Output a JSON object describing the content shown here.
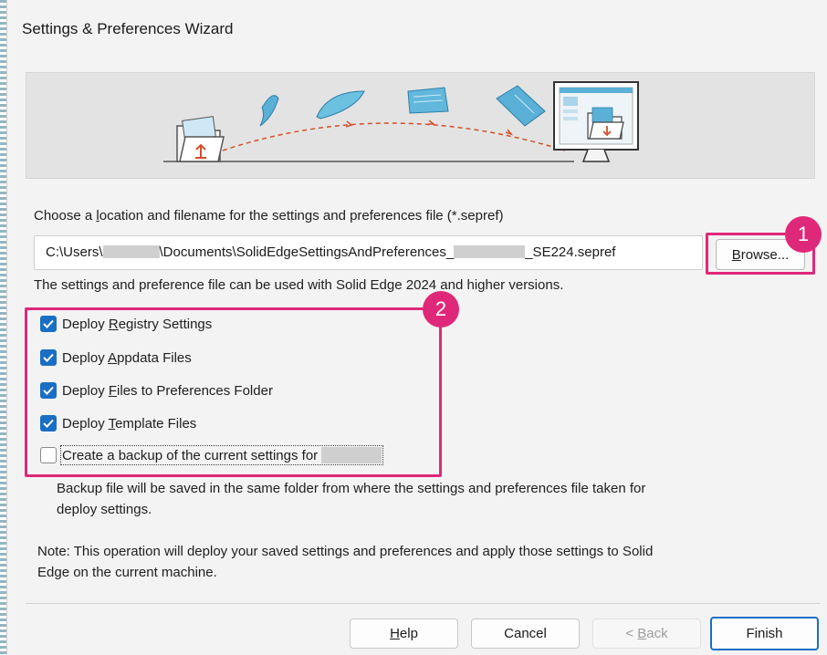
{
  "window": {
    "title": "Settings & Preferences Wizard"
  },
  "file_section": {
    "prompt_pre": "Choose a ",
    "prompt_hotkey": "l",
    "prompt_post": "ocation and filename for the settings and preferences file (*.sepref)",
    "path_part1": "C:\\Users\\",
    "path_part2": "\\Documents\\SolidEdgeSettingsAndPreferences_",
    "path_part3": "_SE224.sepref",
    "browse_hotkey": "B",
    "browse_rest": "rowse...",
    "compat_note": "The settings and preference file can be used with Solid Edge 2024 and higher versions."
  },
  "options": [
    {
      "pre": "Deploy ",
      "hotkey": "R",
      "post": "egistry Settings",
      "checked": true
    },
    {
      "pre": "Deploy ",
      "hotkey": "A",
      "post": "ppdata Files",
      "checked": true
    },
    {
      "pre": "Deploy ",
      "hotkey": "F",
      "post": "iles to Preferences Folder",
      "checked": true
    },
    {
      "pre": "Deploy ",
      "hotkey": "T",
      "post": "emplate Files",
      "checked": true
    },
    {
      "pre": "Create a backup of the current settings for ",
      "hotkey": "",
      "post": "",
      "checked": false
    }
  ],
  "backup_note_line1": "Backup file will be saved in the same folder from where the settings and preferences file taken for",
  "backup_note_line2": "deploy settings.",
  "note_line1": "Note: This operation will deploy your saved settings and preferences and apply those settings to Solid",
  "note_line2": "Edge on the current machine.",
  "annotations": {
    "badge1": "1",
    "badge2": "2",
    "color": "#e0287a"
  },
  "footer": {
    "help_hotkey": "H",
    "help_rest": "elp",
    "cancel": "Cancel",
    "back_pre": "< ",
    "back_hotkey": "B",
    "back_rest": "ack",
    "finish": "Finish"
  },
  "icons": {
    "checkbox_checked": "checkmark-icon",
    "folder_export": "folder-export-icon",
    "monitor_import": "monitor-import-icon"
  }
}
